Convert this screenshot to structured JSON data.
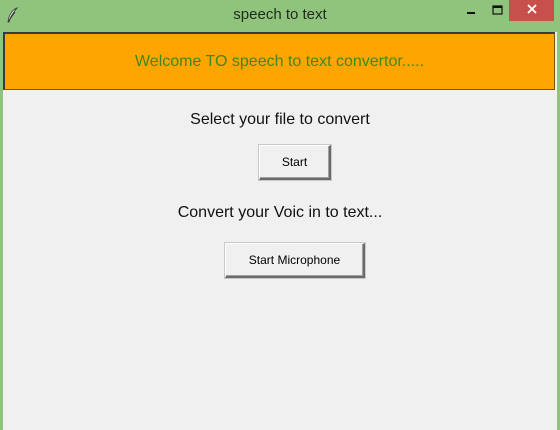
{
  "window": {
    "title": "speech to text",
    "icon": "feather-icon",
    "controls": [
      "minimize-icon",
      "maximize-icon",
      "close-icon"
    ],
    "frame_color": "#90c47c",
    "close_color": "#c7504a"
  },
  "banner": {
    "text": "Welcome TO speech to text convertor.....",
    "background": "#ffa500",
    "text_color": "#3c8a1e"
  },
  "file_section": {
    "label": "Select your file to convert",
    "button_label": "Start"
  },
  "mic_section": {
    "label": "Convert your Voic in to text...",
    "button_label": "Start Microphone"
  }
}
